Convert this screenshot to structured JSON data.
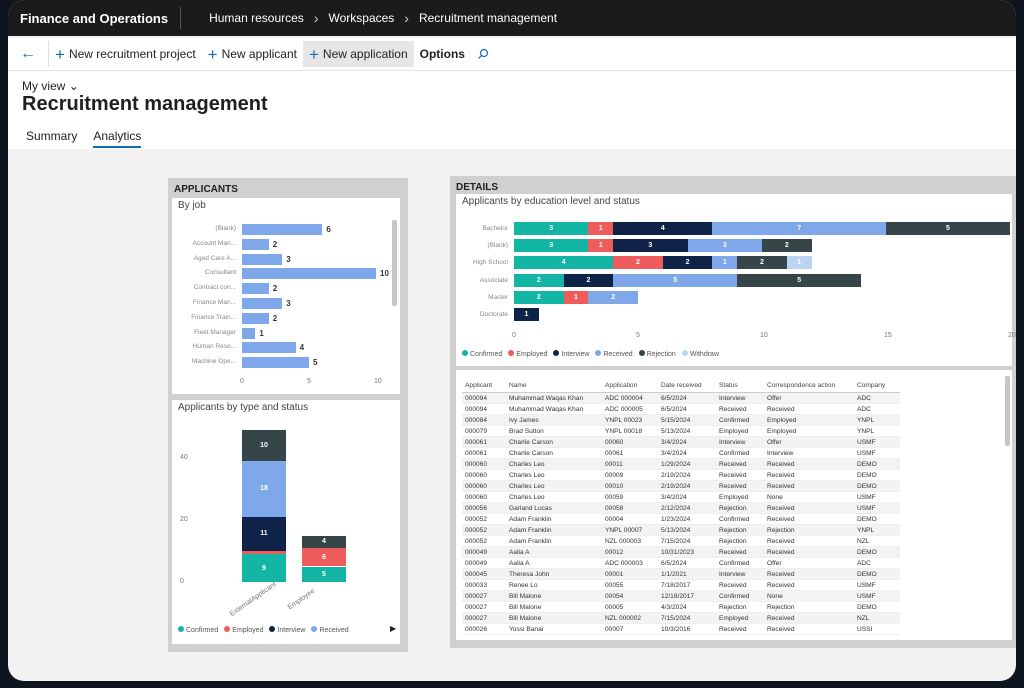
{
  "topbar": {
    "app_title": "Finance and Operations",
    "breadcrumb": [
      "Human resources",
      "Workspaces",
      "Recruitment management"
    ]
  },
  "actionbar": {
    "new_recruitment_project": "New recruitment project",
    "new_applicant": "New applicant",
    "new_application": "New application",
    "options": "Options"
  },
  "header": {
    "my_view": "My view",
    "title": "Recruitment management",
    "tabs": [
      "Summary",
      "Analytics"
    ]
  },
  "applicants": {
    "panel_title": "APPLICANTS",
    "by_job": {
      "title": "By job",
      "categories": [
        "(Blank)",
        "Account Man...",
        "Aged Care A...",
        "Consultant",
        "Contract con...",
        "Finance Man...",
        "Finance Train...",
        "Fleet Manager",
        "Human Reso...",
        "Machine Ope..."
      ],
      "values": [
        6,
        2,
        3,
        10,
        2,
        3,
        2,
        1,
        4,
        5
      ],
      "x_ticks": [
        "0",
        "5",
        "10"
      ]
    },
    "by_type": {
      "title": "Applicants by type and status",
      "y_ticks": [
        "40",
        "20",
        "0"
      ],
      "categories": [
        "ExternalApplicant",
        "Employee"
      ],
      "series": [
        {
          "name": "Confirmed",
          "values": [
            9,
            5
          ]
        },
        {
          "name": "Employed",
          "values": [
            1,
            6
          ]
        },
        {
          "name": "Interview",
          "values": [
            11,
            0
          ]
        },
        {
          "name": "Received",
          "values": [
            18,
            0
          ]
        },
        {
          "name": "Rejection",
          "values": [
            10,
            4
          ]
        }
      ],
      "legend": [
        "Confirmed",
        "Employed",
        "Interview",
        "Received"
      ]
    }
  },
  "details": {
    "panel_title": "DETAILS",
    "chart_title": "Applicants by education level and status",
    "x_ticks": [
      "0",
      "5",
      "10",
      "15",
      "20"
    ],
    "legend": [
      "Confirmed",
      "Employed",
      "Interview",
      "Received",
      "Rejection",
      "Withdraw"
    ],
    "table": {
      "columns": [
        "Applicant",
        "Name",
        "Application",
        "Date received",
        "Status",
        "Correspondence action",
        "Company"
      ],
      "rows": [
        [
          "000094",
          "Muhammad Waqas Khan",
          "ADC 000004",
          "6/5/2024",
          "Interview",
          "Offer",
          "ADC"
        ],
        [
          "000094",
          "Muhammad Waqas Khan",
          "ADC 000005",
          "6/5/2024",
          "Received",
          "Received",
          "ADC"
        ],
        [
          "000084",
          "Ivy James",
          "YNPL 00023",
          "5/15/2024",
          "Confirmed",
          "Employed",
          "YNPL"
        ],
        [
          "000079",
          "Brad Sutton",
          "YNPL 00018",
          "5/13/2024",
          "Employed",
          "Employed",
          "YNPL"
        ],
        [
          "000061",
          "Charlie Carson",
          "00060",
          "3/4/2024",
          "Interview",
          "Offer",
          "USMF"
        ],
        [
          "000061",
          "Charlie Carson",
          "00061",
          "3/4/2024",
          "Confirmed",
          "Interview",
          "USMF"
        ],
        [
          "000060",
          "Charles Leo",
          "00011",
          "1/29/2024",
          "Received",
          "Received",
          "DEMO"
        ],
        [
          "000060",
          "Charles Leo",
          "00009",
          "2/19/2024",
          "Received",
          "Received",
          "DEMO"
        ],
        [
          "000060",
          "Charles Leo",
          "00010",
          "2/19/2024",
          "Received",
          "Received",
          "DEMO"
        ],
        [
          "000060",
          "Charles Leo",
          "00059",
          "3/4/2024",
          "Employed",
          "None",
          "USMF"
        ],
        [
          "000056",
          "Garland Lucas",
          "00058",
          "2/12/2024",
          "Rejection",
          "Received",
          "USMF"
        ],
        [
          "000052",
          "Adam Franklin",
          "00004",
          "1/23/2024",
          "Confirmed",
          "Received",
          "DEMO"
        ],
        [
          "000052",
          "Adam Franklin",
          "YNPL 00007",
          "5/13/2024",
          "Rejection",
          "Rejection",
          "YNPL"
        ],
        [
          "000052",
          "Adam Franklin",
          "NZL 000003",
          "7/15/2024",
          "Rejection",
          "Received",
          "NZL"
        ],
        [
          "000049",
          "Aalia A",
          "00012",
          "10/31/2023",
          "Received",
          "Received",
          "DEMO"
        ],
        [
          "000049",
          "Aalia A",
          "ADC 000003",
          "6/5/2024",
          "Confirmed",
          "Offer",
          "ADC"
        ],
        [
          "000045",
          "Theresa John",
          "00001",
          "1/1/2021",
          "Interview",
          "Received",
          "DEMO"
        ],
        [
          "000033",
          "Renee Lo",
          "00055",
          "7/18/2017",
          "Received",
          "Received",
          "USMF"
        ],
        [
          "000027",
          "Bill Malone",
          "00054",
          "12/18/2017",
          "Confirmed",
          "None",
          "USMF"
        ],
        [
          "000027",
          "Bill Malone",
          "00005",
          "4/3/2024",
          "Rejection",
          "Rejection",
          "DEMO"
        ],
        [
          "000027",
          "Bill Malone",
          "NZL 000002",
          "7/15/2024",
          "Employed",
          "Received",
          "NZL"
        ],
        [
          "000026",
          "Yossi Banai",
          "00007",
          "10/3/2016",
          "Received",
          "Received",
          "USSI"
        ]
      ]
    }
  },
  "colors": {
    "Confirmed": "#13b6a4",
    "Employed": "#ee5c5c",
    "Interview": "#0e2347",
    "Received": "#7ea8e9",
    "Rejection": "#364548",
    "Withdraw": "#bcd3f3"
  },
  "chart_data": [
    {
      "type": "bar",
      "title": "By job",
      "orientation": "horizontal",
      "categories": [
        "(Blank)",
        "Account Man...",
        "Aged Care A...",
        "Consultant",
        "Contract con...",
        "Finance Man...",
        "Finance Train...",
        "Fleet Manager",
        "Human Reso...",
        "Machine Ope..."
      ],
      "values": [
        6,
        2,
        3,
        10,
        2,
        3,
        2,
        1,
        4,
        5
      ],
      "xlim": [
        0,
        10
      ]
    },
    {
      "type": "bar",
      "title": "Applicants by type and status",
      "stacked": true,
      "categories": [
        "ExternalApplicant",
        "Employee"
      ],
      "series": [
        {
          "name": "Confirmed",
          "values": [
            9,
            5
          ]
        },
        {
          "name": "Employed",
          "values": [
            1,
            6
          ]
        },
        {
          "name": "Interview",
          "values": [
            11,
            0
          ]
        },
        {
          "name": "Received",
          "values": [
            18,
            0
          ]
        },
        {
          "name": "Rejection",
          "values": [
            10,
            4
          ]
        }
      ],
      "ylim": [
        0,
        40
      ]
    },
    {
      "type": "bar",
      "title": "Applicants by education level and status",
      "orientation": "horizontal",
      "stacked": true,
      "categories": [
        "Bachelor",
        "(Blank)",
        "High School",
        "Associate",
        "Master",
        "Doctorate"
      ],
      "series": [
        {
          "name": "Confirmed",
          "values": [
            3,
            3,
            4,
            2,
            2,
            0
          ]
        },
        {
          "name": "Employed",
          "values": [
            1,
            1,
            2,
            0,
            1,
            0
          ]
        },
        {
          "name": "Interview",
          "values": [
            4,
            3,
            2,
            2,
            0,
            1
          ]
        },
        {
          "name": "Received",
          "values": [
            7,
            3,
            1,
            5,
            2,
            0
          ]
        },
        {
          "name": "Rejection",
          "values": [
            5,
            2,
            2,
            5,
            0,
            0
          ]
        },
        {
          "name": "Withdraw",
          "values": [
            0,
            0,
            1,
            0,
            0,
            0
          ]
        }
      ],
      "xlim": [
        0,
        20
      ]
    }
  ]
}
